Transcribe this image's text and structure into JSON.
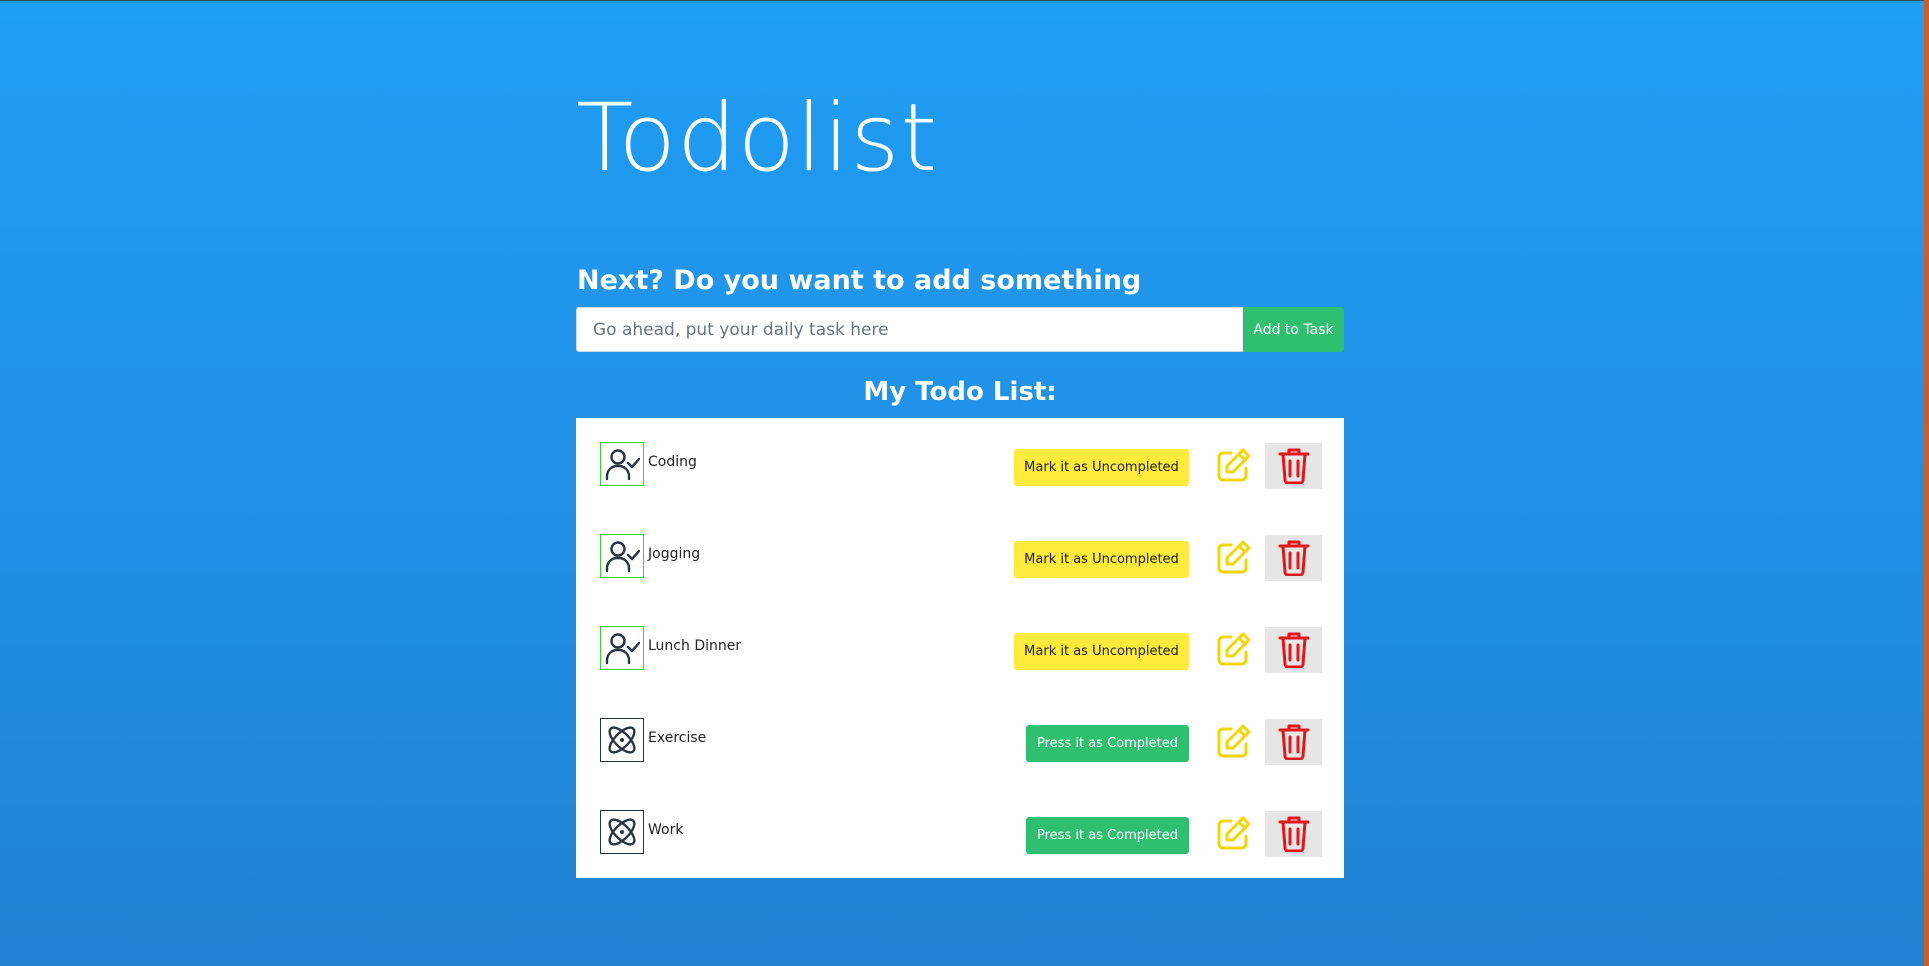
{
  "app": {
    "title": "Todolist"
  },
  "add_form": {
    "heading": "Next? Do you want to add something",
    "input_placeholder": "Go ahead, put your daily task here",
    "input_value": "",
    "add_button_label": "Add to Task"
  },
  "list": {
    "heading": "My Todo List:",
    "items": [
      {
        "label": "Coding",
        "completed": true,
        "status_icon": "user-check-icon",
        "toggle_label": "Mark it as Uncompleted"
      },
      {
        "label": "Jogging",
        "completed": true,
        "status_icon": "user-check-icon",
        "toggle_label": "Mark it as Uncompleted"
      },
      {
        "label": "Lunch Dinner",
        "completed": true,
        "status_icon": "user-check-icon",
        "toggle_label": "Mark it as Uncompleted"
      },
      {
        "label": "Exercise",
        "completed": false,
        "status_icon": "atom-icon",
        "toggle_label": "Press it as Completed"
      },
      {
        "label": "Work",
        "completed": false,
        "status_icon": "atom-icon",
        "toggle_label": "Press it as Completed"
      }
    ]
  },
  "colors": {
    "background_top": "#1f9ef6",
    "background_bottom": "#2082d3",
    "success_green": "#2fbf71",
    "warning_yellow": "#ffeb3b",
    "edit_icon_yellow": "#f2d600",
    "delete_icon_red": "#e01818",
    "completed_border": "#35d42c"
  },
  "icons": {
    "edit": "pencil-square-icon",
    "delete": "trash-icon"
  }
}
